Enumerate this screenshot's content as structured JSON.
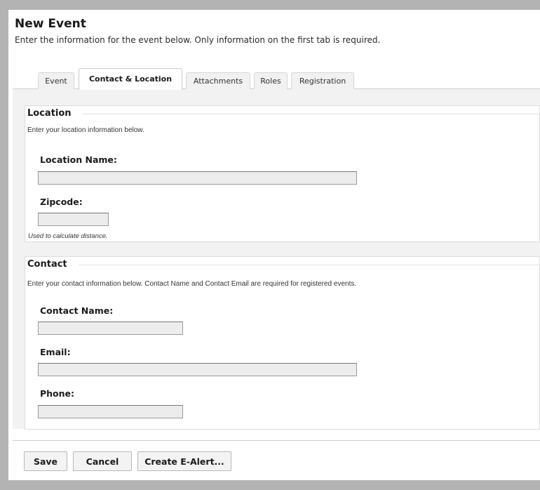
{
  "header": {
    "title": "New Event",
    "subtitle": "Enter the information for the event below. Only information on the first tab is required."
  },
  "tabs": [
    {
      "label": "Event",
      "active": false
    },
    {
      "label": "Contact & Location",
      "active": true
    },
    {
      "label": "Attachments",
      "active": false
    },
    {
      "label": "Roles",
      "active": false
    },
    {
      "label": "Registration",
      "active": false
    }
  ],
  "location": {
    "legend": "Location",
    "description": "Enter your location information below.",
    "location_name_label": "Location Name:",
    "location_name_value": "",
    "zipcode_label": "Zipcode:",
    "zipcode_value": "",
    "zipcode_hint": "Used to calculate distance."
  },
  "contact": {
    "legend": "Contact",
    "description": "Enter your contact information below. Contact Name and Contact Email are required for registered events.",
    "name_label": "Contact Name:",
    "name_value": "",
    "email_label": "Email:",
    "email_value": "",
    "phone_label": "Phone:",
    "phone_value": ""
  },
  "buttons": {
    "save": "Save",
    "cancel": "Cancel",
    "create_alert": "Create E-Alert..."
  }
}
